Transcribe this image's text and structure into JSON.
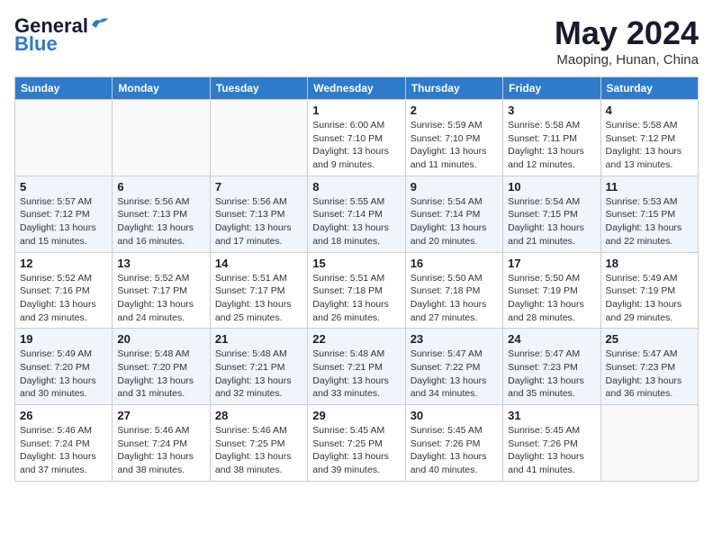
{
  "logo": {
    "text_general": "General",
    "text_blue": "Blue"
  },
  "title": {
    "month_year": "May 2024",
    "location": "Maoping, Hunan, China"
  },
  "days_of_week": [
    "Sunday",
    "Monday",
    "Tuesday",
    "Wednesday",
    "Thursday",
    "Friday",
    "Saturday"
  ],
  "weeks": [
    [
      {
        "day": "",
        "sunrise": "",
        "sunset": "",
        "daylight": ""
      },
      {
        "day": "",
        "sunrise": "",
        "sunset": "",
        "daylight": ""
      },
      {
        "day": "",
        "sunrise": "",
        "sunset": "",
        "daylight": ""
      },
      {
        "day": "1",
        "sunrise": "Sunrise: 6:00 AM",
        "sunset": "Sunset: 7:10 PM",
        "daylight": "Daylight: 13 hours and 9 minutes."
      },
      {
        "day": "2",
        "sunrise": "Sunrise: 5:59 AM",
        "sunset": "Sunset: 7:10 PM",
        "daylight": "Daylight: 13 hours and 11 minutes."
      },
      {
        "day": "3",
        "sunrise": "Sunrise: 5:58 AM",
        "sunset": "Sunset: 7:11 PM",
        "daylight": "Daylight: 13 hours and 12 minutes."
      },
      {
        "day": "4",
        "sunrise": "Sunrise: 5:58 AM",
        "sunset": "Sunset: 7:12 PM",
        "daylight": "Daylight: 13 hours and 13 minutes."
      }
    ],
    [
      {
        "day": "5",
        "sunrise": "Sunrise: 5:57 AM",
        "sunset": "Sunset: 7:12 PM",
        "daylight": "Daylight: 13 hours and 15 minutes."
      },
      {
        "day": "6",
        "sunrise": "Sunrise: 5:56 AM",
        "sunset": "Sunset: 7:13 PM",
        "daylight": "Daylight: 13 hours and 16 minutes."
      },
      {
        "day": "7",
        "sunrise": "Sunrise: 5:56 AM",
        "sunset": "Sunset: 7:13 PM",
        "daylight": "Daylight: 13 hours and 17 minutes."
      },
      {
        "day": "8",
        "sunrise": "Sunrise: 5:55 AM",
        "sunset": "Sunset: 7:14 PM",
        "daylight": "Daylight: 13 hours and 18 minutes."
      },
      {
        "day": "9",
        "sunrise": "Sunrise: 5:54 AM",
        "sunset": "Sunset: 7:14 PM",
        "daylight": "Daylight: 13 hours and 20 minutes."
      },
      {
        "day": "10",
        "sunrise": "Sunrise: 5:54 AM",
        "sunset": "Sunset: 7:15 PM",
        "daylight": "Daylight: 13 hours and 21 minutes."
      },
      {
        "day": "11",
        "sunrise": "Sunrise: 5:53 AM",
        "sunset": "Sunset: 7:15 PM",
        "daylight": "Daylight: 13 hours and 22 minutes."
      }
    ],
    [
      {
        "day": "12",
        "sunrise": "Sunrise: 5:52 AM",
        "sunset": "Sunset: 7:16 PM",
        "daylight": "Daylight: 13 hours and 23 minutes."
      },
      {
        "day": "13",
        "sunrise": "Sunrise: 5:52 AM",
        "sunset": "Sunset: 7:17 PM",
        "daylight": "Daylight: 13 hours and 24 minutes."
      },
      {
        "day": "14",
        "sunrise": "Sunrise: 5:51 AM",
        "sunset": "Sunset: 7:17 PM",
        "daylight": "Daylight: 13 hours and 25 minutes."
      },
      {
        "day": "15",
        "sunrise": "Sunrise: 5:51 AM",
        "sunset": "Sunset: 7:18 PM",
        "daylight": "Daylight: 13 hours and 26 minutes."
      },
      {
        "day": "16",
        "sunrise": "Sunrise: 5:50 AM",
        "sunset": "Sunset: 7:18 PM",
        "daylight": "Daylight: 13 hours and 27 minutes."
      },
      {
        "day": "17",
        "sunrise": "Sunrise: 5:50 AM",
        "sunset": "Sunset: 7:19 PM",
        "daylight": "Daylight: 13 hours and 28 minutes."
      },
      {
        "day": "18",
        "sunrise": "Sunrise: 5:49 AM",
        "sunset": "Sunset: 7:19 PM",
        "daylight": "Daylight: 13 hours and 29 minutes."
      }
    ],
    [
      {
        "day": "19",
        "sunrise": "Sunrise: 5:49 AM",
        "sunset": "Sunset: 7:20 PM",
        "daylight": "Daylight: 13 hours and 30 minutes."
      },
      {
        "day": "20",
        "sunrise": "Sunrise: 5:48 AM",
        "sunset": "Sunset: 7:20 PM",
        "daylight": "Daylight: 13 hours and 31 minutes."
      },
      {
        "day": "21",
        "sunrise": "Sunrise: 5:48 AM",
        "sunset": "Sunset: 7:21 PM",
        "daylight": "Daylight: 13 hours and 32 minutes."
      },
      {
        "day": "22",
        "sunrise": "Sunrise: 5:48 AM",
        "sunset": "Sunset: 7:21 PM",
        "daylight": "Daylight: 13 hours and 33 minutes."
      },
      {
        "day": "23",
        "sunrise": "Sunrise: 5:47 AM",
        "sunset": "Sunset: 7:22 PM",
        "daylight": "Daylight: 13 hours and 34 minutes."
      },
      {
        "day": "24",
        "sunrise": "Sunrise: 5:47 AM",
        "sunset": "Sunset: 7:23 PM",
        "daylight": "Daylight: 13 hours and 35 minutes."
      },
      {
        "day": "25",
        "sunrise": "Sunrise: 5:47 AM",
        "sunset": "Sunset: 7:23 PM",
        "daylight": "Daylight: 13 hours and 36 minutes."
      }
    ],
    [
      {
        "day": "26",
        "sunrise": "Sunrise: 5:46 AM",
        "sunset": "Sunset: 7:24 PM",
        "daylight": "Daylight: 13 hours and 37 minutes."
      },
      {
        "day": "27",
        "sunrise": "Sunrise: 5:46 AM",
        "sunset": "Sunset: 7:24 PM",
        "daylight": "Daylight: 13 hours and 38 minutes."
      },
      {
        "day": "28",
        "sunrise": "Sunrise: 5:46 AM",
        "sunset": "Sunset: 7:25 PM",
        "daylight": "Daylight: 13 hours and 38 minutes."
      },
      {
        "day": "29",
        "sunrise": "Sunrise: 5:45 AM",
        "sunset": "Sunset: 7:25 PM",
        "daylight": "Daylight: 13 hours and 39 minutes."
      },
      {
        "day": "30",
        "sunrise": "Sunrise: 5:45 AM",
        "sunset": "Sunset: 7:26 PM",
        "daylight": "Daylight: 13 hours and 40 minutes."
      },
      {
        "day": "31",
        "sunrise": "Sunrise: 5:45 AM",
        "sunset": "Sunset: 7:26 PM",
        "daylight": "Daylight: 13 hours and 41 minutes."
      },
      {
        "day": "",
        "sunrise": "",
        "sunset": "",
        "daylight": ""
      }
    ]
  ]
}
